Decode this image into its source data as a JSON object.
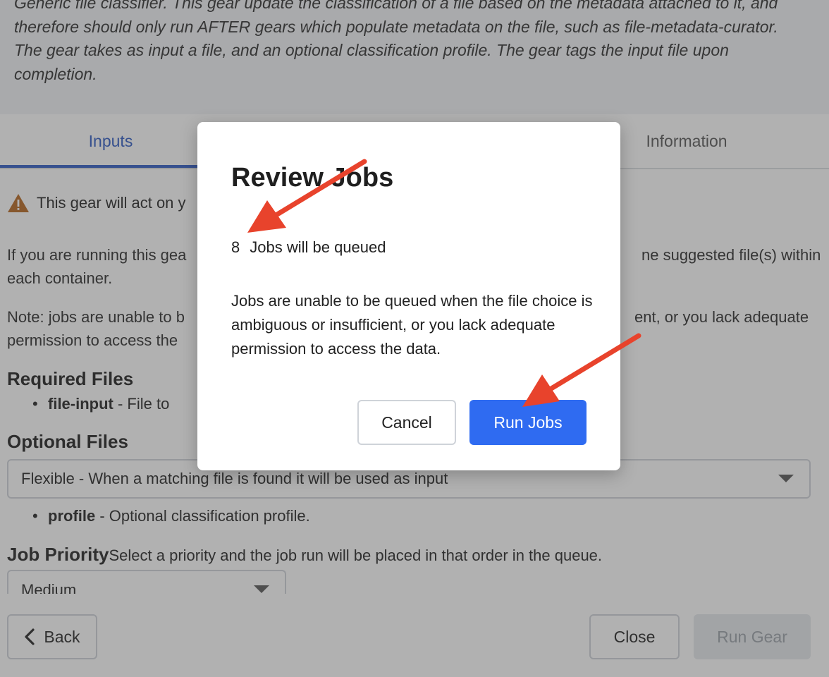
{
  "description": "Generic file classifier. This gear update the classification of a file based on the metadata attached to it, and therefore should only run AFTER gears which populate metadata on the file, such as file-metadata-curator. The gear takes as input a file, and an optional classification profile. The gear tags the input file upon completion.",
  "tabs": [
    {
      "label": "Inputs",
      "active": true
    },
    {
      "label": "Information",
      "active": false
    }
  ],
  "warning_text": "This gear will act on y",
  "body": {
    "running_line_1": "If you are running this gea",
    "running_line_1_end": "ne suggested file(s) within",
    "running_line_2": "each container.",
    "note_line_1": "Note: jobs are unable to b",
    "note_line_1_end": "ent, or you lack adequate",
    "note_line_2": "permission to access the"
  },
  "required_files": {
    "heading": "Required Files",
    "items": [
      {
        "name": "file-input",
        "desc": " - File to"
      }
    ]
  },
  "optional_files": {
    "heading": "Optional Files",
    "select_value": "Flexible - When a matching file is found it will be used as input",
    "items": [
      {
        "name": "profile",
        "desc": " - Optional classification profile."
      }
    ]
  },
  "job_priority": {
    "label": "Job Priority",
    "hint": "Select a priority and the job run will be placed in that order in the queue.",
    "value": "Medium"
  },
  "footer": {
    "back_label": "Back",
    "close_label": "Close",
    "run_gear_label": "Run Gear"
  },
  "modal": {
    "title": "Review Jobs",
    "job_count": "8",
    "queued_text": "Jobs will be queued",
    "note": "Jobs are unable to be queued when the file choice is ambiguous or insufficient, or you lack adequate permission to access the data.",
    "cancel_label": "Cancel",
    "run_jobs_label": "Run Jobs"
  },
  "colors": {
    "accent": "#2f6bf1",
    "tab_active": "#2b59c3",
    "arrow": "#e8432c",
    "warning": "#b5651d"
  }
}
